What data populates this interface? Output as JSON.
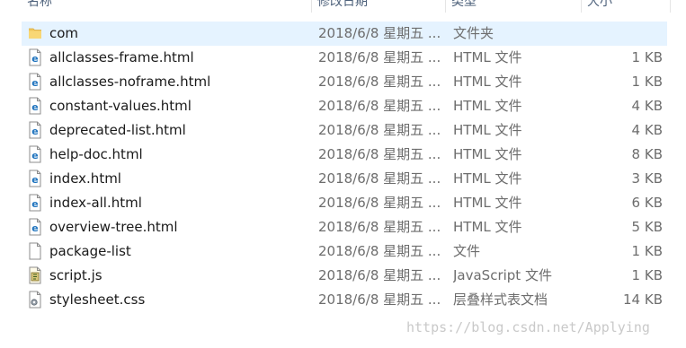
{
  "columns": {
    "name": "名称",
    "date": "修改日期",
    "type": "类型",
    "size": "大小"
  },
  "files": [
    {
      "name": "com",
      "date": "2018/6/8 星期五 ...",
      "type": "文件夹",
      "size": "",
      "icon": "folder-icon",
      "selected": true
    },
    {
      "name": "allclasses-frame.html",
      "date": "2018/6/8 星期五 ...",
      "type": "HTML 文件",
      "size": "1 KB",
      "icon": "html-file-icon"
    },
    {
      "name": "allclasses-noframe.html",
      "date": "2018/6/8 星期五 ...",
      "type": "HTML 文件",
      "size": "1 KB",
      "icon": "html-file-icon"
    },
    {
      "name": "constant-values.html",
      "date": "2018/6/8 星期五 ...",
      "type": "HTML 文件",
      "size": "4 KB",
      "icon": "html-file-icon"
    },
    {
      "name": "deprecated-list.html",
      "date": "2018/6/8 星期五 ...",
      "type": "HTML 文件",
      "size": "4 KB",
      "icon": "html-file-icon"
    },
    {
      "name": "help-doc.html",
      "date": "2018/6/8 星期五 ...",
      "type": "HTML 文件",
      "size": "8 KB",
      "icon": "html-file-icon"
    },
    {
      "name": "index.html",
      "date": "2018/6/8 星期五 ...",
      "type": "HTML 文件",
      "size": "3 KB",
      "icon": "html-file-icon"
    },
    {
      "name": "index-all.html",
      "date": "2018/6/8 星期五 ...",
      "type": "HTML 文件",
      "size": "6 KB",
      "icon": "html-file-icon"
    },
    {
      "name": "overview-tree.html",
      "date": "2018/6/8 星期五 ...",
      "type": "HTML 文件",
      "size": "5 KB",
      "icon": "html-file-icon"
    },
    {
      "name": "package-list",
      "date": "2018/6/8 星期五 ...",
      "type": "文件",
      "size": "1 KB",
      "icon": "blank-file-icon"
    },
    {
      "name": "script.js",
      "date": "2018/6/8 星期五 ...",
      "type": "JavaScript 文件",
      "size": "1 KB",
      "icon": "script-file-icon"
    },
    {
      "name": "stylesheet.css",
      "date": "2018/6/8 星期五 ...",
      "type": "层叠样式表文档",
      "size": "14 KB",
      "icon": "css-file-icon"
    }
  ],
  "watermark": "https://blog.csdn.net/Applying",
  "colors": {
    "selection": "#e5f3ff",
    "header_text": "#4c607a",
    "secondary_text": "#6d6d6d",
    "folder": "#f0c75e",
    "html_icon": "#1e73be"
  }
}
